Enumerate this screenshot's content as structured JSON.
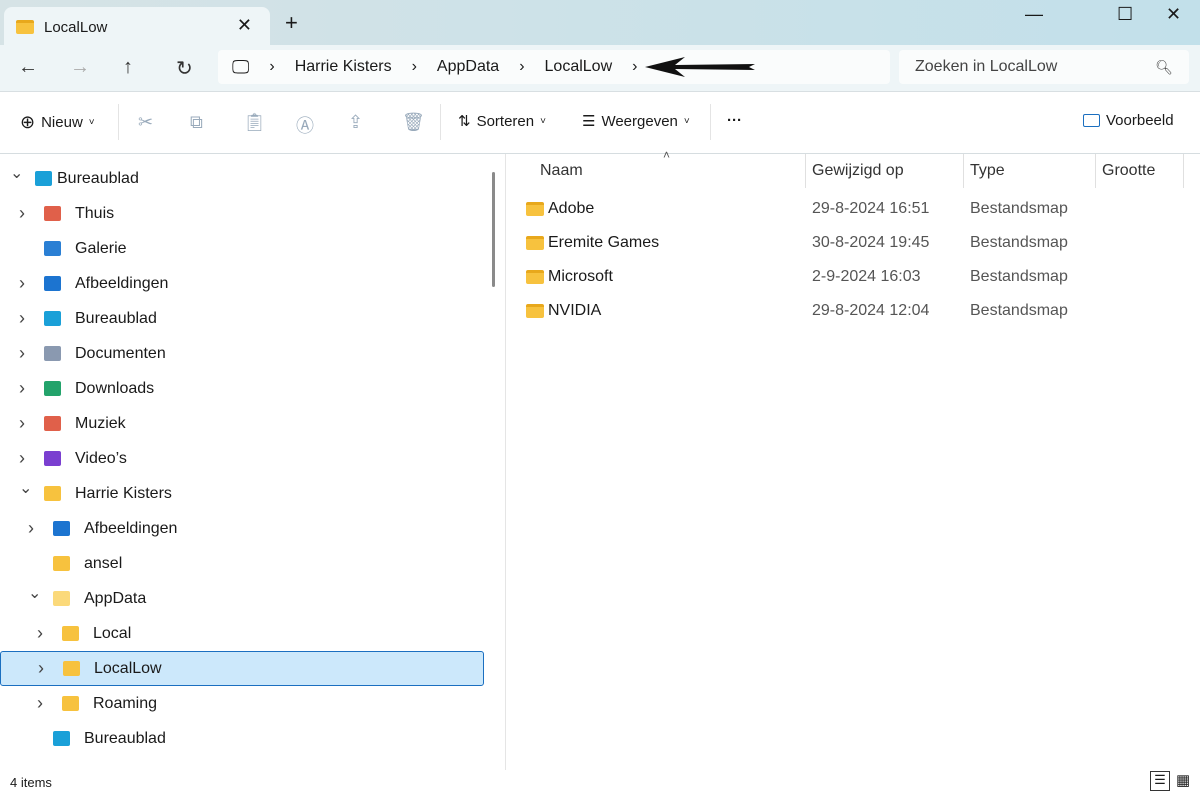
{
  "window": {
    "tab_title": "LocalLow",
    "new_tab": "+",
    "minimize": "—",
    "maximize": "☐",
    "close": "✕"
  },
  "address": {
    "crumbs": [
      "Harrie Kisters",
      "AppData",
      "LocalLow"
    ],
    "search_placeholder": "Zoeken in LocalLow"
  },
  "toolbar": {
    "new_label": "Nieuw",
    "sort_label": "Sorteren",
    "view_label": "Weergeven",
    "more": "···",
    "preview_label": "Voorbeeld"
  },
  "sidebar": {
    "items": [
      {
        "label": "Bureaublad",
        "level": 0,
        "expanded": true,
        "icon": "desktop-icon"
      },
      {
        "label": "Thuis",
        "level": 1,
        "chevron": true,
        "icon": "home-icon"
      },
      {
        "label": "Galerie",
        "level": 1,
        "chevron": false,
        "icon": "gallery-icon"
      },
      {
        "label": "Afbeeldingen",
        "level": 1,
        "chevron": true,
        "icon": "pictures-icon"
      },
      {
        "label": "Bureaublad",
        "level": 1,
        "chevron": true,
        "icon": "desktop-icon"
      },
      {
        "label": "Documenten",
        "level": 1,
        "chevron": true,
        "icon": "documents-icon"
      },
      {
        "label": "Downloads",
        "level": 1,
        "chevron": true,
        "icon": "download-icon"
      },
      {
        "label": "Muziek",
        "level": 1,
        "chevron": true,
        "icon": "music-icon"
      },
      {
        "label": "Video’s",
        "level": 1,
        "chevron": true,
        "icon": "video-icon"
      },
      {
        "label": "Harrie Kisters",
        "level": 1,
        "expanded": true,
        "icon": "folder-icon"
      },
      {
        "label": "Afbeeldingen",
        "level": 2,
        "chevron": true,
        "icon": "pictures-icon"
      },
      {
        "label": "ansel",
        "level": 2,
        "chevron": false,
        "icon": "folder-icon"
      },
      {
        "label": "AppData",
        "level": 2,
        "expanded": true,
        "icon": "folder-open-icon"
      },
      {
        "label": "Local",
        "level": 3,
        "chevron": true,
        "icon": "folder-icon"
      },
      {
        "label": "LocalLow",
        "level": 3,
        "chevron": true,
        "icon": "folder-icon",
        "selected": true
      },
      {
        "label": "Roaming",
        "level": 3,
        "chevron": true,
        "icon": "folder-icon"
      },
      {
        "label": "Bureaublad",
        "level": 2,
        "chevron": false,
        "icon": "desktop-icon"
      }
    ]
  },
  "columns": [
    "Naam",
    "Gewijzigd op",
    "Type",
    "Grootte"
  ],
  "files": [
    {
      "name": "Adobe",
      "modified": "29-8-2024 16:51",
      "type": "Bestandsmap",
      "size": ""
    },
    {
      "name": "Eremite Games",
      "modified": "30-8-2024 19:45",
      "type": "Bestandsmap",
      "size": ""
    },
    {
      "name": "Microsoft",
      "modified": "2-9-2024 16:03",
      "type": "Bestandsmap",
      "size": ""
    },
    {
      "name": "NVIDIA",
      "modified": "29-8-2024 12:04",
      "type": "Bestandsmap",
      "size": ""
    }
  ],
  "status": {
    "count": "4 items"
  },
  "colors": {
    "folder": "#f7c23e",
    "selection": "#cce8fb",
    "selection_border": "#1b6fc0"
  }
}
